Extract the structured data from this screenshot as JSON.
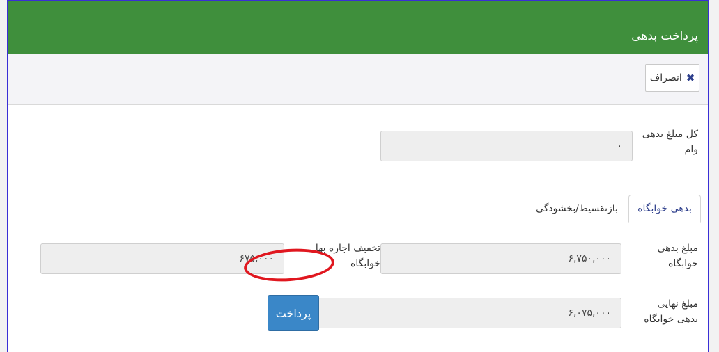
{
  "header": {
    "title": "پرداخت بدهی"
  },
  "toolbar": {
    "cancel_label": "انصراف",
    "cancel_icon": "close-icon"
  },
  "summary": {
    "total_debt_label": "کل مبلغ بدهی وام",
    "total_debt_value": "۰"
  },
  "tabs": [
    {
      "label": "بدهی خوابگاه",
      "active": true
    },
    {
      "label": "بازتقسیط/بخشودگی",
      "active": false
    }
  ],
  "dorm": {
    "debt_label": "مبلغ بدهی خوابگاه",
    "debt_value": "۶,۷۵۰,۰۰۰",
    "discount_label": "تخفیف اجاره بها خوابگاه",
    "discount_value": "۶۷۵,۰۰۰",
    "final_label": "مبلغ نهایی بدهی خوابگاه",
    "final_value": "۶,۰۷۵,۰۰۰",
    "pay_label": "پرداخت"
  },
  "colors": {
    "header_bg": "#3f8f3c",
    "primary_button": "#3a87c8",
    "annotation": "#e0171f"
  }
}
